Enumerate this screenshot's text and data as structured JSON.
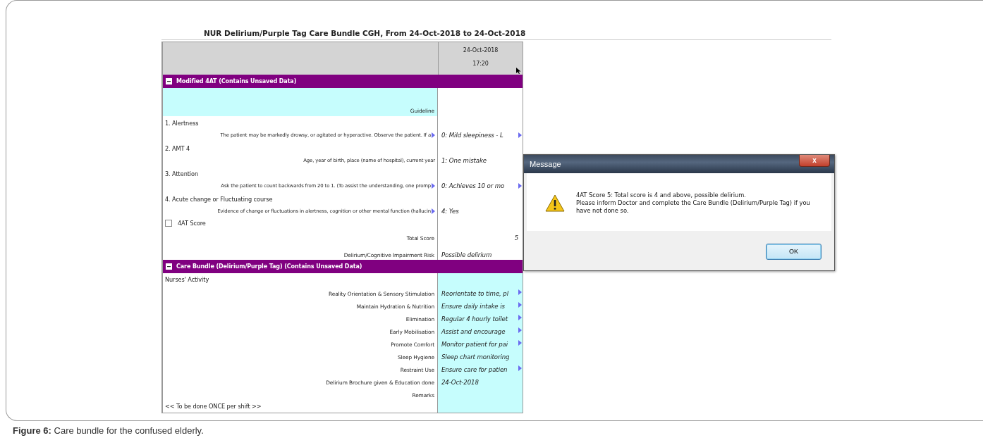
{
  "report_title": "NUR Delirium/Purple Tag Care Bundle CGH, From 24-Oct-2018 to 24-Oct-2018",
  "grid": {
    "column_header": {
      "date": "24-Oct-2018",
      "time": "17:20"
    },
    "sections": [
      {
        "title": "Modified 4AT (Contains Unsaved Data)",
        "expanded": true,
        "values_highlighted": false,
        "rows": [
          {
            "kind": "guideline",
            "label": "Guideline"
          },
          {
            "kind": "item",
            "title": "1. Alertness",
            "description": "The patient may be markedly drowsy, or agitated or hyperactive. Observe the patient. If a",
            "description_more": true,
            "value": "0: Mild sleepiness - L",
            "value_more": true
          },
          {
            "kind": "item",
            "title": "2. AMT 4",
            "description": "Age, year of birth, place (name of hospital), current year",
            "description_more": false,
            "value": "1: One mistake",
            "value_more": false
          },
          {
            "kind": "item",
            "title": "3. Attention",
            "description": "Ask the patient to count backwards from 20 to 1. (To assist the understanding, one promp",
            "description_more": true,
            "value": "0: Achieves 10 or mo",
            "value_more": true
          },
          {
            "kind": "item",
            "title": "4. Acute change or Fluctuating course",
            "description": "Evidence of change or fluctuations in alertness, cognition or other mental function (hallucin",
            "description_more": true,
            "value": "4: Yes",
            "value_more": false
          },
          {
            "kind": "checkbox",
            "label": "4AT Score",
            "checked": false
          },
          {
            "kind": "total",
            "label": "Total Score",
            "value": "5"
          },
          {
            "kind": "field",
            "label": "Delirium/Cognitive Impairment Risk",
            "value": "Possible delirium",
            "value_more": false
          }
        ]
      },
      {
        "title": "Care Bundle (Delirium/Purple Tag) (Contains Unsaved Data)",
        "expanded": true,
        "values_highlighted": true,
        "rows": [
          {
            "kind": "note",
            "label": "Nurses' Activity"
          },
          {
            "kind": "field",
            "label": "Reality Orientation & Sensory Stimulation",
            "value": "Reorientate to time, pl",
            "value_more": true
          },
          {
            "kind": "field",
            "label": "Maintain Hydration & Nutrition",
            "value": "Ensure daily intake is",
            "value_more": true
          },
          {
            "kind": "field",
            "label": "Elimination",
            "value": "Regular 4 hourly toilet",
            "value_more": true
          },
          {
            "kind": "field",
            "label": "Early Mobilisation",
            "value": "Assist and encourage",
            "value_more": true
          },
          {
            "kind": "field",
            "label": "Promote Comfort",
            "value": "Monitor patient for pai",
            "value_more": true
          },
          {
            "kind": "field",
            "label": "Sleep Hygiene",
            "value": "Sleep chart monitoring",
            "value_more": false
          },
          {
            "kind": "field",
            "label": "Restraint Use",
            "value": "Ensure care for patien",
            "value_more": true
          },
          {
            "kind": "field",
            "label": "Delirium Brochure given & Education done",
            "value": "24-Oct-2018",
            "value_more": false
          },
          {
            "kind": "field",
            "label": "Remarks"
          },
          {
            "kind": "note",
            "label": "<< To be done ONCE per shift >>"
          }
        ]
      }
    ]
  },
  "dialog": {
    "title": "Message",
    "close": "x",
    "message_lines": [
      "4AT Score 5: Total score is 4 and above, possible delirium.",
      "Please inform Doctor and complete the Care Bundle (Delirium/Purple Tag) if you have not done so."
    ],
    "button": "OK"
  },
  "caption": "**Figure 6:** Care bundle for the confused elderly."
}
